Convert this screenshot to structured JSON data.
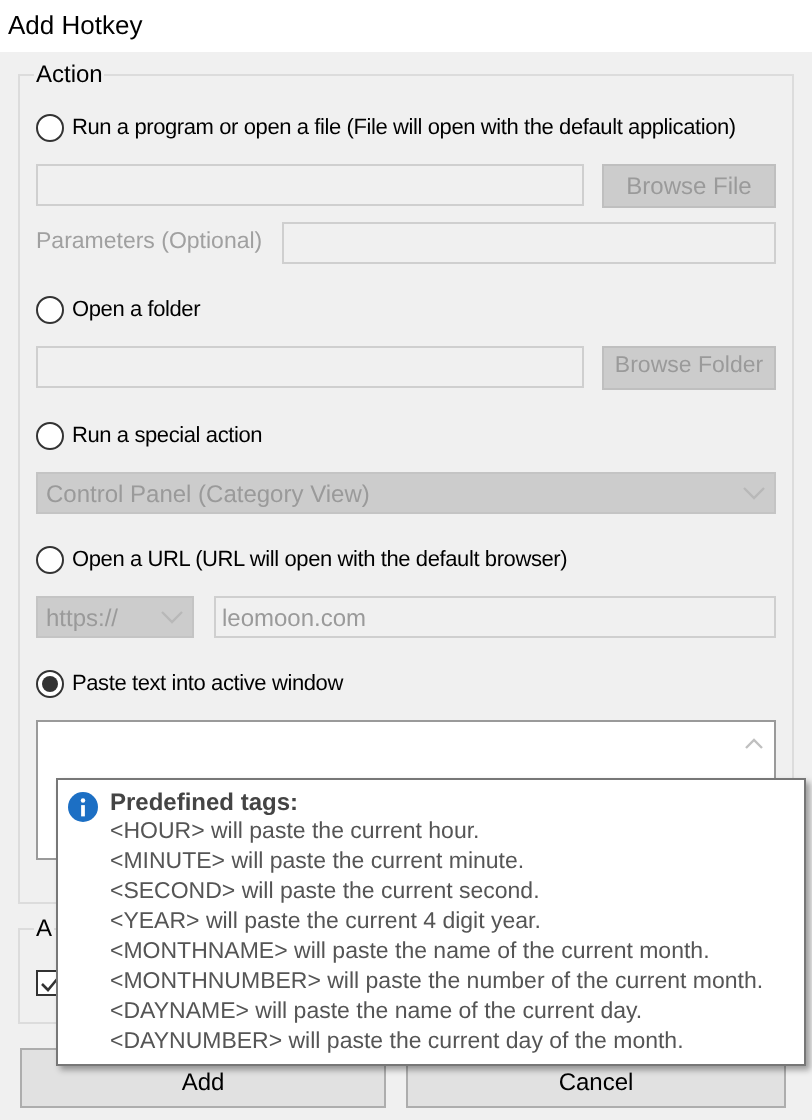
{
  "window": {
    "title": "Add Hotkey"
  },
  "action_group": {
    "label": "Action",
    "options": [
      {
        "kind": "file",
        "label": "Run a program or open a file (File will open with the default application)",
        "selected": false,
        "button": "Browse File",
        "parameters_label": "Parameters (Optional)"
      },
      {
        "kind": "folder",
        "label": "Open a folder",
        "selected": false,
        "button": "Browse Folder"
      },
      {
        "kind": "special",
        "label": "Run a special action",
        "selected": false,
        "value": "Control Panel (Category View)"
      },
      {
        "kind": "url",
        "label": "Open a URL (URL will open with the default browser)",
        "selected": false,
        "protocol": "https://",
        "value": "leomoon.com"
      },
      {
        "kind": "paste",
        "label": "Paste text into active window",
        "selected": true
      }
    ]
  },
  "assign_group": {
    "label": "A",
    "checkbox": {
      "checked": true
    }
  },
  "tooltip": {
    "title": "Predefined tags:",
    "lines": [
      "<HOUR> will paste the current hour.",
      "<MINUTE> will paste the current minute.",
      "<SECOND> will paste the current second.",
      "<YEAR> will paste the current 4 digit year.",
      "<MONTHNAME> will paste the name of the current month.",
      "<MONTHNUMBER> will paste the number of the current month.",
      "<DAYNAME> will paste the name of the current day.",
      "<DAYNUMBER> will paste the current day of the month."
    ]
  },
  "buttons": [
    "Add",
    "Cancel"
  ]
}
